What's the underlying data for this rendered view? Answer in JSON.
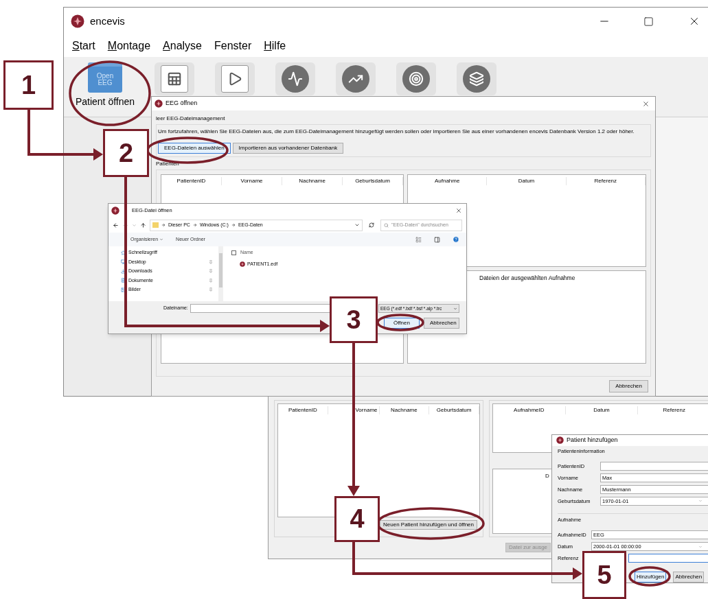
{
  "main_window": {
    "title": "encevis",
    "menu": [
      {
        "label": "Start",
        "underline": true
      },
      {
        "label": "Montage",
        "underline": true
      },
      {
        "label": "Analyse",
        "underline": true
      },
      {
        "label": "Fenster",
        "underline": false
      },
      {
        "label": "Hilfe",
        "underline": true
      }
    ],
    "toolbar": [
      {
        "kind": "open",
        "icon_text": "Open EEG",
        "label": "Patient öffnen"
      },
      {
        "kind": "table"
      },
      {
        "kind": "video"
      },
      {
        "kind": "pulse"
      },
      {
        "kind": "trend"
      },
      {
        "kind": "target"
      },
      {
        "kind": "layers"
      }
    ]
  },
  "eeg_dialog": {
    "title": "EEG öffnen",
    "group_title": "leer EEG-Dateimanagement",
    "instructions": "Um fortzufahren, wählen Sie EEG-Dateien aus, die zum EEG-Dateimanagement hinzugefügt werden sollen oder importieren Sie aus einer vorhandenen encevis Datenbank Version 1.2 oder höher.",
    "buttons": [
      {
        "label": "EEG-Dateien auswählen",
        "focused": true
      },
      {
        "label": "Importieren aus vorhandener Datenbank",
        "focused": false
      }
    ],
    "patients_title": "Patienten",
    "patient_columns": [
      "PatientenID",
      "Vorname",
      "Nachname",
      "Geburtsdatum"
    ],
    "recording_columns": [
      "Aufnahme",
      "Datum",
      "Referenz"
    ],
    "files_label": "Dateien der ausgewählten Aufnahme",
    "cancel": "Abbrechen"
  },
  "file_dialog": {
    "title": "EEG-Datei öffnen",
    "breadcrumb": [
      "Dieser PC",
      "Windows (C:)",
      "EEG-Daten"
    ],
    "search_placeholder": "\"EEG-Daten\" durchsuchen",
    "commands": [
      "Organisieren",
      "Neuer Ordner"
    ],
    "nav": [
      {
        "kind": "star",
        "label": "Schnellzugriff"
      },
      {
        "kind": "desktop",
        "label": "Desktop"
      },
      {
        "kind": "download",
        "label": "Downloads"
      },
      {
        "kind": "document",
        "label": "Dokumente"
      },
      {
        "kind": "image",
        "label": "Bilder"
      }
    ],
    "name_column": "Name",
    "select_all_checked": false,
    "files": [
      "PATIENT1.edf"
    ],
    "filename_label": "Dateiname:",
    "filter": "EEG (*.edf *.bdf *.bsf *.alp *.trc",
    "buttons": [
      {
        "label": "Öffnen",
        "focused": true
      },
      {
        "label": "Abbrechen",
        "focused": false
      }
    ]
  },
  "patient_window": {
    "patient_columns": [
      "PatientenID",
      "Vorname",
      "Nachname",
      "Geburtsdatum"
    ],
    "recording_columns": [
      "AufnahmeID",
      "Datum",
      "Referenz"
    ],
    "files_label": "D",
    "add_button": "Neuen Patient hinzufügen und öffnen",
    "assign_button": {
      "label": "Datei zur ausge",
      "disabled": true
    }
  },
  "add_dialog": {
    "title": "Patient hinzufügen",
    "sections": [
      {
        "title": "Patienteninformation",
        "fields": [
          {
            "label": "PatientenID",
            "kind": "text",
            "focused": false
          },
          {
            "label": "Vorname",
            "value": "Max",
            "kind": "text",
            "focused": false
          },
          {
            "label": "Nachname",
            "value": "Mustermann",
            "kind": "text",
            "focused": false
          },
          {
            "label": "Geburtsdatum",
            "value": "1970-01-01",
            "kind": "dropdown",
            "focused": false
          }
        ]
      },
      {
        "title": "Aufnahme",
        "fields": [
          {
            "label": "AufnahmeID",
            "value": "EEG",
            "kind": "text",
            "focused": false
          },
          {
            "label": "Datum",
            "value": "2000-01-01 00:00:00",
            "kind": "dropdown",
            "focused": false
          },
          {
            "label": "Referenz",
            "kind": "text",
            "focused": true
          }
        ]
      }
    ],
    "buttons": [
      {
        "label": "Hinzufügen",
        "focused": true
      },
      {
        "label": "Abbrechen",
        "focused": false
      }
    ]
  },
  "callouts": [
    "1",
    "2",
    "3",
    "4",
    "5"
  ]
}
